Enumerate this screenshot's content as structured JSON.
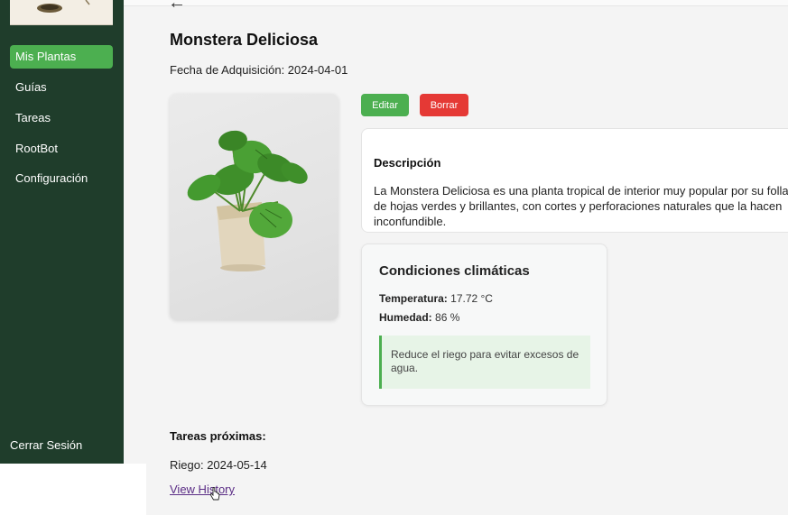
{
  "sidebar": {
    "logo": "plant-logo-icon",
    "items": [
      {
        "label": "Mis Plantas",
        "active": true
      },
      {
        "label": "Guías"
      },
      {
        "label": "Tareas"
      },
      {
        "label": "RootBot"
      },
      {
        "label": "Configuración"
      }
    ],
    "logout_label": "Cerrar Sesión"
  },
  "main": {
    "back_icon": "arrow-left-icon",
    "plant_name": "Monstera Deliciosa",
    "acquisition": "Fecha de Adquisición: 2024-04-01",
    "photo": "monstera-plant-photo",
    "actions": {
      "edit_label": "Editar",
      "delete_label": "Borrar"
    },
    "description": {
      "title": "Descripción",
      "text": "La Monstera Deliciosa es una planta tropical de interior muy popular por su follaje grande, de hojas verdes y brillantes, con cortes y perforaciones naturales que la hacen inconfundible."
    },
    "climate": {
      "title": "Condiciones climáticas",
      "temperature_label": "Temperatura:",
      "temperature_value": "17.72 °C",
      "humidity_label": "Humedad:",
      "humidity_value": "86 %",
      "advice": "Reduce el riego para evitar excesos de agua."
    },
    "tasks": {
      "title": "Tareas próximas:",
      "items": [
        "Riego: 2024-05-14"
      ]
    },
    "history_link": "View History"
  },
  "colors": {
    "sidebar_bg": "#1f3d2b",
    "accent": "#4caf50",
    "danger": "#e53935",
    "link": "#5b2d86"
  }
}
